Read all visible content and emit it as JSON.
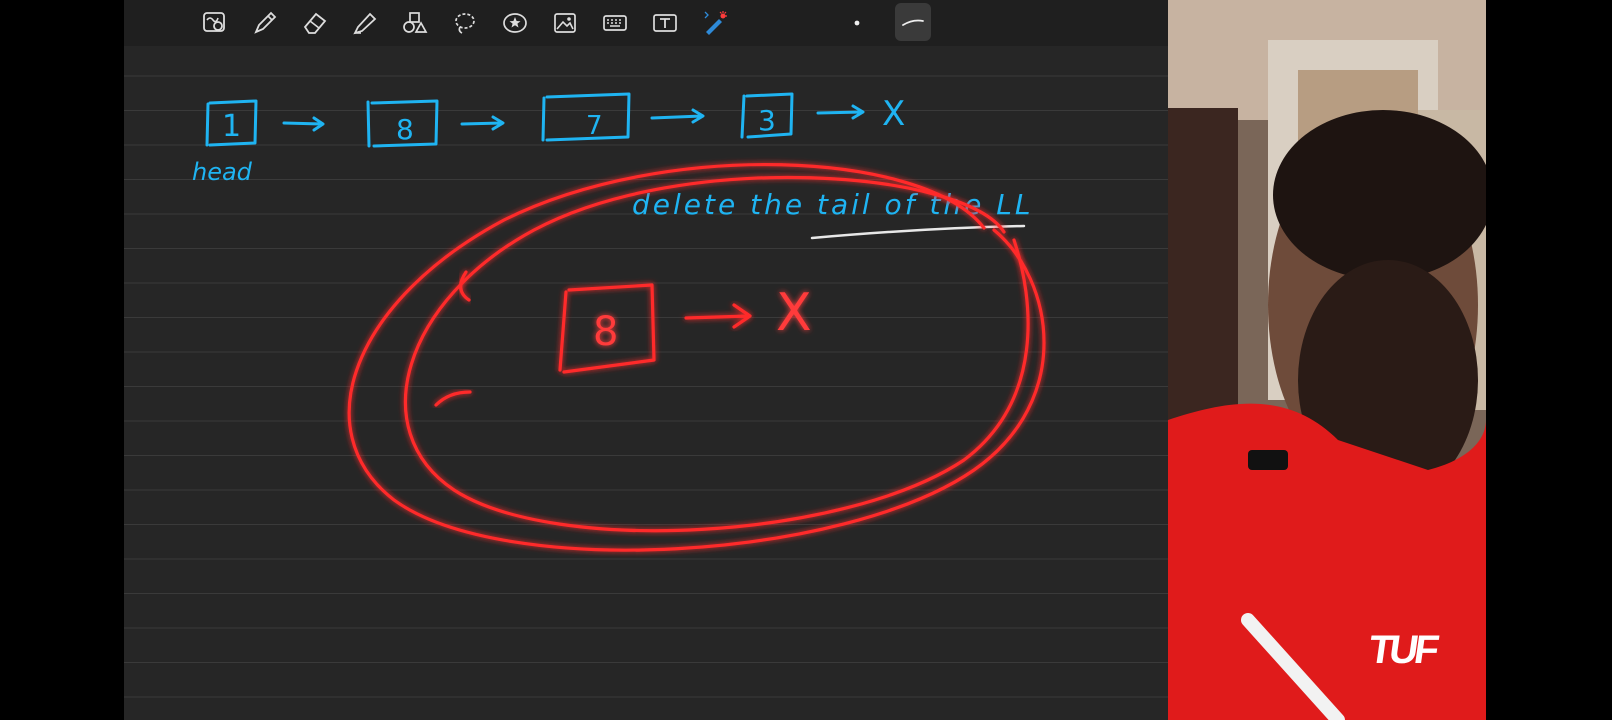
{
  "toolbar": {
    "tools": [
      {
        "name": "zoom-icon"
      },
      {
        "name": "pen-icon"
      },
      {
        "name": "eraser-icon"
      },
      {
        "name": "highlighter-icon"
      },
      {
        "name": "shapes-icon"
      },
      {
        "name": "lasso-icon"
      },
      {
        "name": "sticker-icon"
      },
      {
        "name": "image-icon"
      },
      {
        "name": "keyboard-icon"
      },
      {
        "name": "text-box-icon"
      },
      {
        "name": "laser-pointer-icon"
      }
    ],
    "pen_width_selected": "thin-stroke-icon"
  },
  "notes": {
    "list_nodes": [
      "1",
      "8",
      "7",
      "3"
    ],
    "list_end": "X",
    "head_label": "head",
    "heading": "delete the tail of the LL",
    "circled_node": "8",
    "circled_end": "X"
  },
  "colors": {
    "ink_blue": "#1fb4f2",
    "ink_red": "#ff2b2b",
    "paper": "#262626"
  },
  "video_overlay": {
    "logo_text": "TUF"
  }
}
